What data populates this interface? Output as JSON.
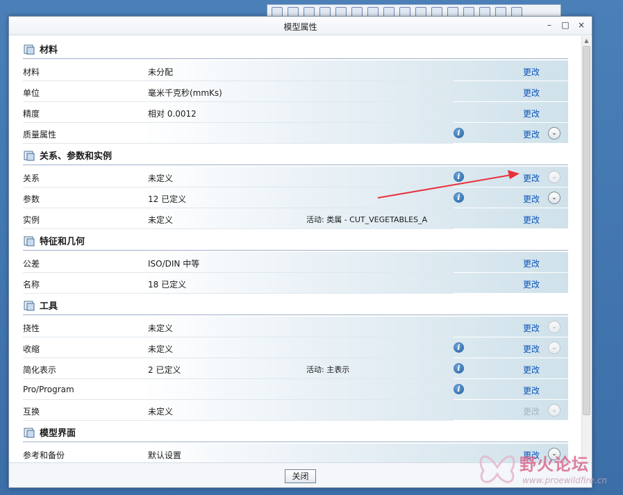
{
  "dialog": {
    "title": "模型属性",
    "window_buttons": [
      "–",
      "□",
      "×"
    ],
    "close_label": "关闭"
  },
  "sections": [
    {
      "title": "材料",
      "icon": "material-icon",
      "rows": [
        {
          "label": "材料",
          "value": "未分配",
          "value2": "",
          "info": false,
          "change": "更改",
          "change_enabled": true,
          "expander": "none"
        },
        {
          "label": "单位",
          "value": "毫米千克秒(mmKs)",
          "value2": "",
          "info": false,
          "change": "更改",
          "change_enabled": true,
          "expander": "none"
        },
        {
          "label": "精度",
          "value": "相对 0.0012",
          "value2": "",
          "info": false,
          "change": "更改",
          "change_enabled": true,
          "expander": "none"
        },
        {
          "label": "质量属性",
          "value": "",
          "value2": "",
          "info": true,
          "change": "更改",
          "change_enabled": true,
          "expander": "normal"
        }
      ]
    },
    {
      "title": "关系、参数和实例",
      "icon": "relations-icon",
      "rows": [
        {
          "label": "关系",
          "value": "未定义",
          "value2": "",
          "info": true,
          "change": "更改",
          "change_enabled": true,
          "expander": "faint"
        },
        {
          "label": "参数",
          "value": "12 已定义",
          "value2": "",
          "info": true,
          "change": "更改",
          "change_enabled": true,
          "expander": "normal"
        },
        {
          "label": "实例",
          "value": "未定义",
          "value2": "活动: 类属 - CUT_VEGETABLES_A",
          "info": false,
          "change": "更改",
          "change_enabled": true,
          "expander": "none"
        }
      ]
    },
    {
      "title": "特征和几何",
      "icon": "geometry-icon",
      "rows": [
        {
          "label": "公差",
          "value": "ISO/DIN 中等",
          "value2": "",
          "info": false,
          "change": "更改",
          "change_enabled": true,
          "expander": "none"
        },
        {
          "label": "名称",
          "value": "18 已定义",
          "value2": "",
          "info": false,
          "change": "更改",
          "change_enabled": true,
          "expander": "none"
        }
      ]
    },
    {
      "title": "工具",
      "icon": "tools-icon",
      "rows": [
        {
          "label": "挠性",
          "value": "未定义",
          "value2": "",
          "info": false,
          "change": "更改",
          "change_enabled": true,
          "expander": "faint"
        },
        {
          "label": "收缩",
          "value": "未定义",
          "value2": "",
          "info": true,
          "change": "更改",
          "change_enabled": true,
          "expander": "faint"
        },
        {
          "label": "简化表示",
          "value": "2 已定义",
          "value2": "活动: 主表示",
          "info": true,
          "change": "更改",
          "change_enabled": true,
          "expander": "none"
        },
        {
          "label": "Pro/Program",
          "value": "",
          "value2": "",
          "info": true,
          "change": "更改",
          "change_enabled": true,
          "expander": "none"
        },
        {
          "label": "互换",
          "value": "未定义",
          "value2": "",
          "info": false,
          "change": "更改",
          "change_enabled": false,
          "expander": "faint"
        }
      ]
    },
    {
      "title": "模型界面",
      "icon": "interface-icon",
      "rows": [
        {
          "label": "参考和备份",
          "value": "默认设置",
          "value2": "",
          "info": false,
          "change": "更改",
          "change_enabled": true,
          "expander": "normal"
        }
      ]
    }
  ],
  "watermark": {
    "text": "野火论坛",
    "url": "www.proewildfire.cn"
  },
  "colors": {
    "link": "#0b54b8",
    "annotation_arrow": "#e8303a"
  }
}
